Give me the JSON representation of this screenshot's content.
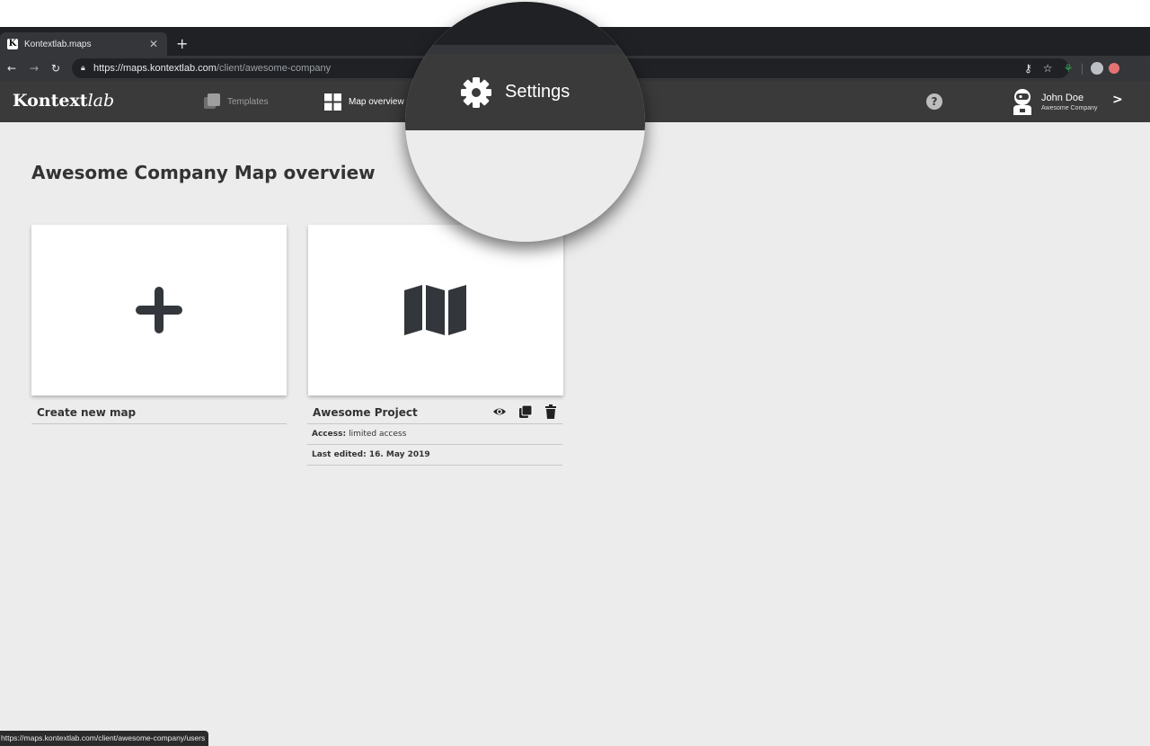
{
  "browser": {
    "tab": {
      "title": "Kontextlab.maps",
      "favicon_letter": "K"
    },
    "new_tab_label": "+",
    "url": {
      "host": "https://maps.kontextlab.com",
      "path": "/client/awesome-company"
    },
    "status_url": "https://maps.kontextlab.com/client/awesome-company/users"
  },
  "header": {
    "logo_main": "Kontext",
    "logo_italic": "lab",
    "nav": {
      "templates": "Templates",
      "map_overview": "Map overview"
    },
    "user": {
      "name": "John Doe",
      "company": "Awesome Company"
    }
  },
  "magnifier": {
    "label": "Settings"
  },
  "main": {
    "title": "Awesome Company Map overview",
    "cards": {
      "create": {
        "title": "Create new map"
      },
      "project": {
        "title": "Awesome Project",
        "access_label": "Access:",
        "access_value": "limited access",
        "edited": "Last edited: 16. May 2019"
      }
    }
  },
  "colors": {
    "header_bg": "#3a3a3a",
    "page_bg": "#ececec",
    "icon_dark": "#33363b",
    "nav_inactive": "#9e9e9e"
  }
}
